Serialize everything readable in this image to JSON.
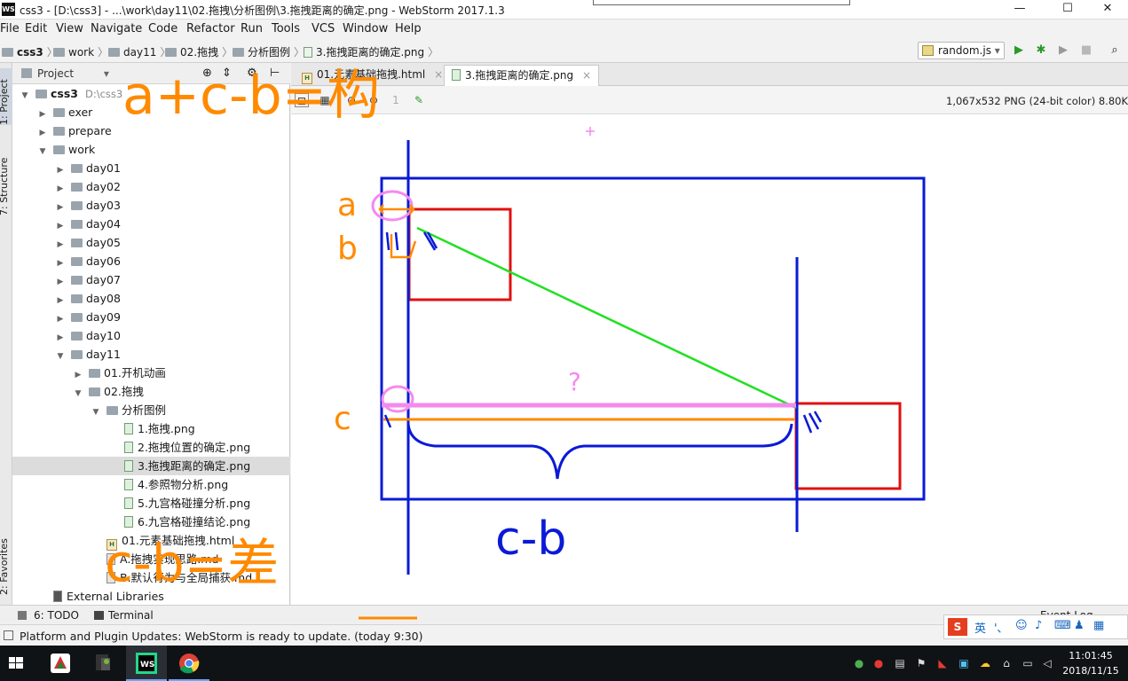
{
  "window": {
    "app_logo": "WS",
    "title": "css3 - [D:\\css3] - ...\\work\\day11\\02.拖拽\\分析图例\\3.拖拽距离的确定.png - WebStorm 2017.1.3",
    "controls": [
      "—",
      "☐",
      "✕"
    ]
  },
  "menu": [
    "File",
    "Edit",
    "View",
    "Navigate",
    "Code",
    "Refactor",
    "Run",
    "Tools",
    "VCS",
    "Window",
    "Help"
  ],
  "breadcrumbs": [
    "css3",
    "work",
    "day11",
    "02.拖拽",
    "分析图例",
    "3.拖拽距离的确定.png"
  ],
  "run_config": "random.js",
  "toolbar_icons": [
    "run-icon",
    "debug-icon",
    "coverage-icon",
    "stop-icon",
    "search-icon"
  ],
  "left_strip": {
    "project": "1: Project",
    "structure": "7: Structure",
    "favorites": "2: Favorites"
  },
  "project_panel": {
    "header": "Project",
    "tree": [
      {
        "label": "css3",
        "extra": "D:\\css3",
        "depth": 0,
        "kind": "folder",
        "open": true,
        "bold": true
      },
      {
        "label": "exer",
        "depth": 1,
        "kind": "folder",
        "open": false
      },
      {
        "label": "prepare",
        "depth": 1,
        "kind": "folder",
        "open": false
      },
      {
        "label": "work",
        "depth": 1,
        "kind": "folder",
        "open": true
      },
      {
        "label": "day01",
        "depth": 2,
        "kind": "folder",
        "open": false
      },
      {
        "label": "day02",
        "depth": 2,
        "kind": "folder",
        "open": false
      },
      {
        "label": "day03",
        "depth": 2,
        "kind": "folder",
        "open": false
      },
      {
        "label": "day04",
        "depth": 2,
        "kind": "folder",
        "open": false
      },
      {
        "label": "day05",
        "depth": 2,
        "kind": "folder",
        "open": false
      },
      {
        "label": "day06",
        "depth": 2,
        "kind": "folder",
        "open": false
      },
      {
        "label": "day07",
        "depth": 2,
        "kind": "folder",
        "open": false
      },
      {
        "label": "day08",
        "depth": 2,
        "kind": "folder",
        "open": false
      },
      {
        "label": "day09",
        "depth": 2,
        "kind": "folder",
        "open": false
      },
      {
        "label": "day10",
        "depth": 2,
        "kind": "folder",
        "open": false
      },
      {
        "label": "day11",
        "depth": 2,
        "kind": "folder",
        "open": true
      },
      {
        "label": "01.开机动画",
        "depth": 3,
        "kind": "folder",
        "open": false
      },
      {
        "label": "02.拖拽",
        "depth": 3,
        "kind": "folder",
        "open": true
      },
      {
        "label": "分析图例",
        "depth": 4,
        "kind": "folder",
        "open": true
      },
      {
        "label": "1.拖拽.png",
        "depth": 5,
        "kind": "png"
      },
      {
        "label": "2.拖拽位置的确定.png",
        "depth": 5,
        "kind": "png"
      },
      {
        "label": "3.拖拽距离的确定.png",
        "depth": 5,
        "kind": "png",
        "selected": true
      },
      {
        "label": "4.参照物分析.png",
        "depth": 5,
        "kind": "png"
      },
      {
        "label": "5.九宫格碰撞分析.png",
        "depth": 5,
        "kind": "png"
      },
      {
        "label": "6.九宫格碰撞结论.png",
        "depth": 5,
        "kind": "png"
      },
      {
        "label": "01.元素基础拖拽.html",
        "depth": 4,
        "kind": "html"
      },
      {
        "label": "A.拖拽实现思路.md",
        "depth": 4,
        "kind": "md"
      },
      {
        "label": "B.默认行为与全局捕获.md",
        "depth": 4,
        "kind": "md"
      },
      {
        "label": "External Libraries",
        "depth": 1,
        "kind": "lib"
      }
    ]
  },
  "editor": {
    "tabs": [
      {
        "label": "01.元素基础拖拽.html",
        "active": false
      },
      {
        "label": "3.拖拽距离的确定.png",
        "active": true
      }
    ],
    "image_info": "1,067x532 PNG (24-bit color) 8.80K",
    "image_toolbar": [
      "fit-icon",
      "grid-icon",
      "zoom-in-icon",
      "zoom-out-icon",
      "actual-size-icon",
      "color-picker-icon"
    ]
  },
  "annotations": {
    "top_formula": "a+c-b=构",
    "side_a": "a",
    "side_b": "b",
    "side_c": "c",
    "question": "?",
    "brace_label": "c-b",
    "bottom_formula": "c-b=差",
    "colors": {
      "orange": "#ff8a00",
      "blue": "#0a1ad6",
      "red": "#e01010",
      "green": "#22e022",
      "pink": "#f48aee"
    }
  },
  "tool_windows": {
    "todo": "6: TODO",
    "terminal": "Terminal",
    "event_log": "Event Log"
  },
  "status": "Platform and Plugin Updates: WebStorm is ready to update. (today 9:30)",
  "ime": {
    "lang": "英"
  },
  "taskbar": {
    "apps": [
      "windows-start-icon",
      "flash-app-icon",
      "terminal-app-icon",
      "webstorm-app-icon",
      "chrome-app-icon"
    ],
    "time": "11:01:45",
    "date": "2018/11/15"
  }
}
